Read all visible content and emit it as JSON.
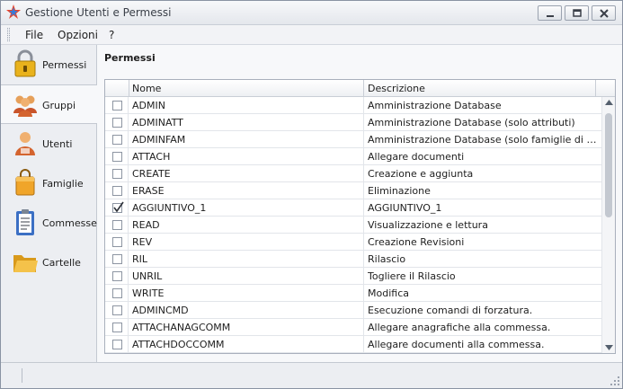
{
  "window": {
    "title": "Gestione Utenti e Permessi",
    "icon": "star-logo-icon"
  },
  "menu": [
    "File",
    "Opzioni",
    "?"
  ],
  "nav": {
    "active": "Permessi",
    "items": [
      {
        "label": "Permessi",
        "icon": "lock-icon"
      },
      {
        "label": "Gruppi",
        "icon": "group-icon"
      },
      {
        "label": "Utenti",
        "icon": "user-icon"
      },
      {
        "label": "Famiglie",
        "icon": "bag-icon"
      },
      {
        "label": "Commesse",
        "icon": "clipboard-icon"
      },
      {
        "label": "Cartelle",
        "icon": "folder-icon"
      }
    ]
  },
  "panel": {
    "title": "Permessi",
    "columns": [
      "Nome",
      "Descrizione"
    ],
    "rows": [
      {
        "name": "ADMIN",
        "description": "Amministrazione Database",
        "checked": false
      },
      {
        "name": "ADMINATT",
        "description": "Amministrazione Database (solo attributi)",
        "checked": false
      },
      {
        "name": "ADMINFAM",
        "description": "Amministrazione Database (solo famiglie di archivi...",
        "checked": false
      },
      {
        "name": "ATTACH",
        "description": "Allegare documenti",
        "checked": false
      },
      {
        "name": "CREATE",
        "description": "Creazione e aggiunta",
        "checked": false
      },
      {
        "name": "ERASE",
        "description": "Eliminazione",
        "checked": false
      },
      {
        "name": "AGGIUNTIVO_1",
        "description": "AGGIUNTIVO_1",
        "checked": true
      },
      {
        "name": "READ",
        "description": "Visualizzazione e lettura",
        "checked": false
      },
      {
        "name": "REV",
        "description": "Creazione Revisioni",
        "checked": false
      },
      {
        "name": "RIL",
        "description": "Rilascio",
        "checked": false
      },
      {
        "name": "UNRIL",
        "description": "Togliere il Rilascio",
        "checked": false
      },
      {
        "name": "WRITE",
        "description": "Modifica",
        "checked": false
      },
      {
        "name": "ADMINCMD",
        "description": "Esecuzione comandi di forzatura.",
        "checked": false
      },
      {
        "name": "ATTACHANAGCOMM",
        "description": "Allegare anagrafiche alla commessa.",
        "checked": false
      },
      {
        "name": "ATTACHDOCCOMM",
        "description": "Allegare documenti alla commessa.",
        "checked": false
      }
    ]
  }
}
